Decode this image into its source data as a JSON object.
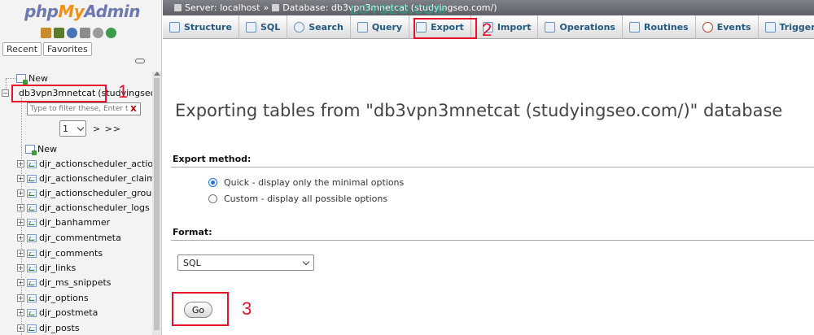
{
  "nav": {
    "logo": {
      "php": "php",
      "my": "My",
      "admin": "Admin"
    },
    "icons": [
      "home-icon",
      "exit-icon",
      "help-icon",
      "docs-icon",
      "settings-icon",
      "reload-icon"
    ],
    "tabs": [
      "Recent",
      "Favorites"
    ],
    "new_root": "New",
    "database": {
      "name": "db3vpn3mnetcat",
      "comment": "(studyingseo.com/)"
    },
    "filter": {
      "placeholder": "Type to filter these, Enter to search all",
      "clear": "X"
    },
    "pager": {
      "page": "1",
      "next": "> >>"
    },
    "new_table": "New",
    "tables": [
      "djr_actionscheduler_actions",
      "djr_actionscheduler_claims",
      "djr_actionscheduler_groups",
      "djr_actionscheduler_logs",
      "djr_banhammer",
      "djr_commentmeta",
      "djr_comments",
      "djr_links",
      "djr_ms_snippets",
      "djr_options",
      "djr_postmeta",
      "djr_posts"
    ]
  },
  "breadcrumb": {
    "server": "Server: localhost",
    "sep": "»",
    "database": "Database: db3vpn3mnetcat (studyingseo.com/)"
  },
  "watermark": "LOYSEO.COM",
  "tabs": [
    "Structure",
    "SQL",
    "Search",
    "Query",
    "Export",
    "Import",
    "Operations",
    "Routines",
    "Events",
    "Triggers"
  ],
  "active_tab": "Export",
  "main": {
    "title": "Exporting tables from \"db3vpn3mnetcat (studyingseo.com/)\" database",
    "export_method_label": "Export method:",
    "methods": [
      {
        "label": "Quick - display only the minimal options",
        "checked": true
      },
      {
        "label": "Custom - display all possible options",
        "checked": false
      }
    ],
    "format_label": "Format:",
    "format_value": "SQL",
    "go_label": "Go"
  },
  "callouts": [
    "1",
    "2",
    "3"
  ],
  "colors": {
    "callout": "#e8102b",
    "tab_text": "#235a81",
    "accent": "#1a73e8"
  }
}
